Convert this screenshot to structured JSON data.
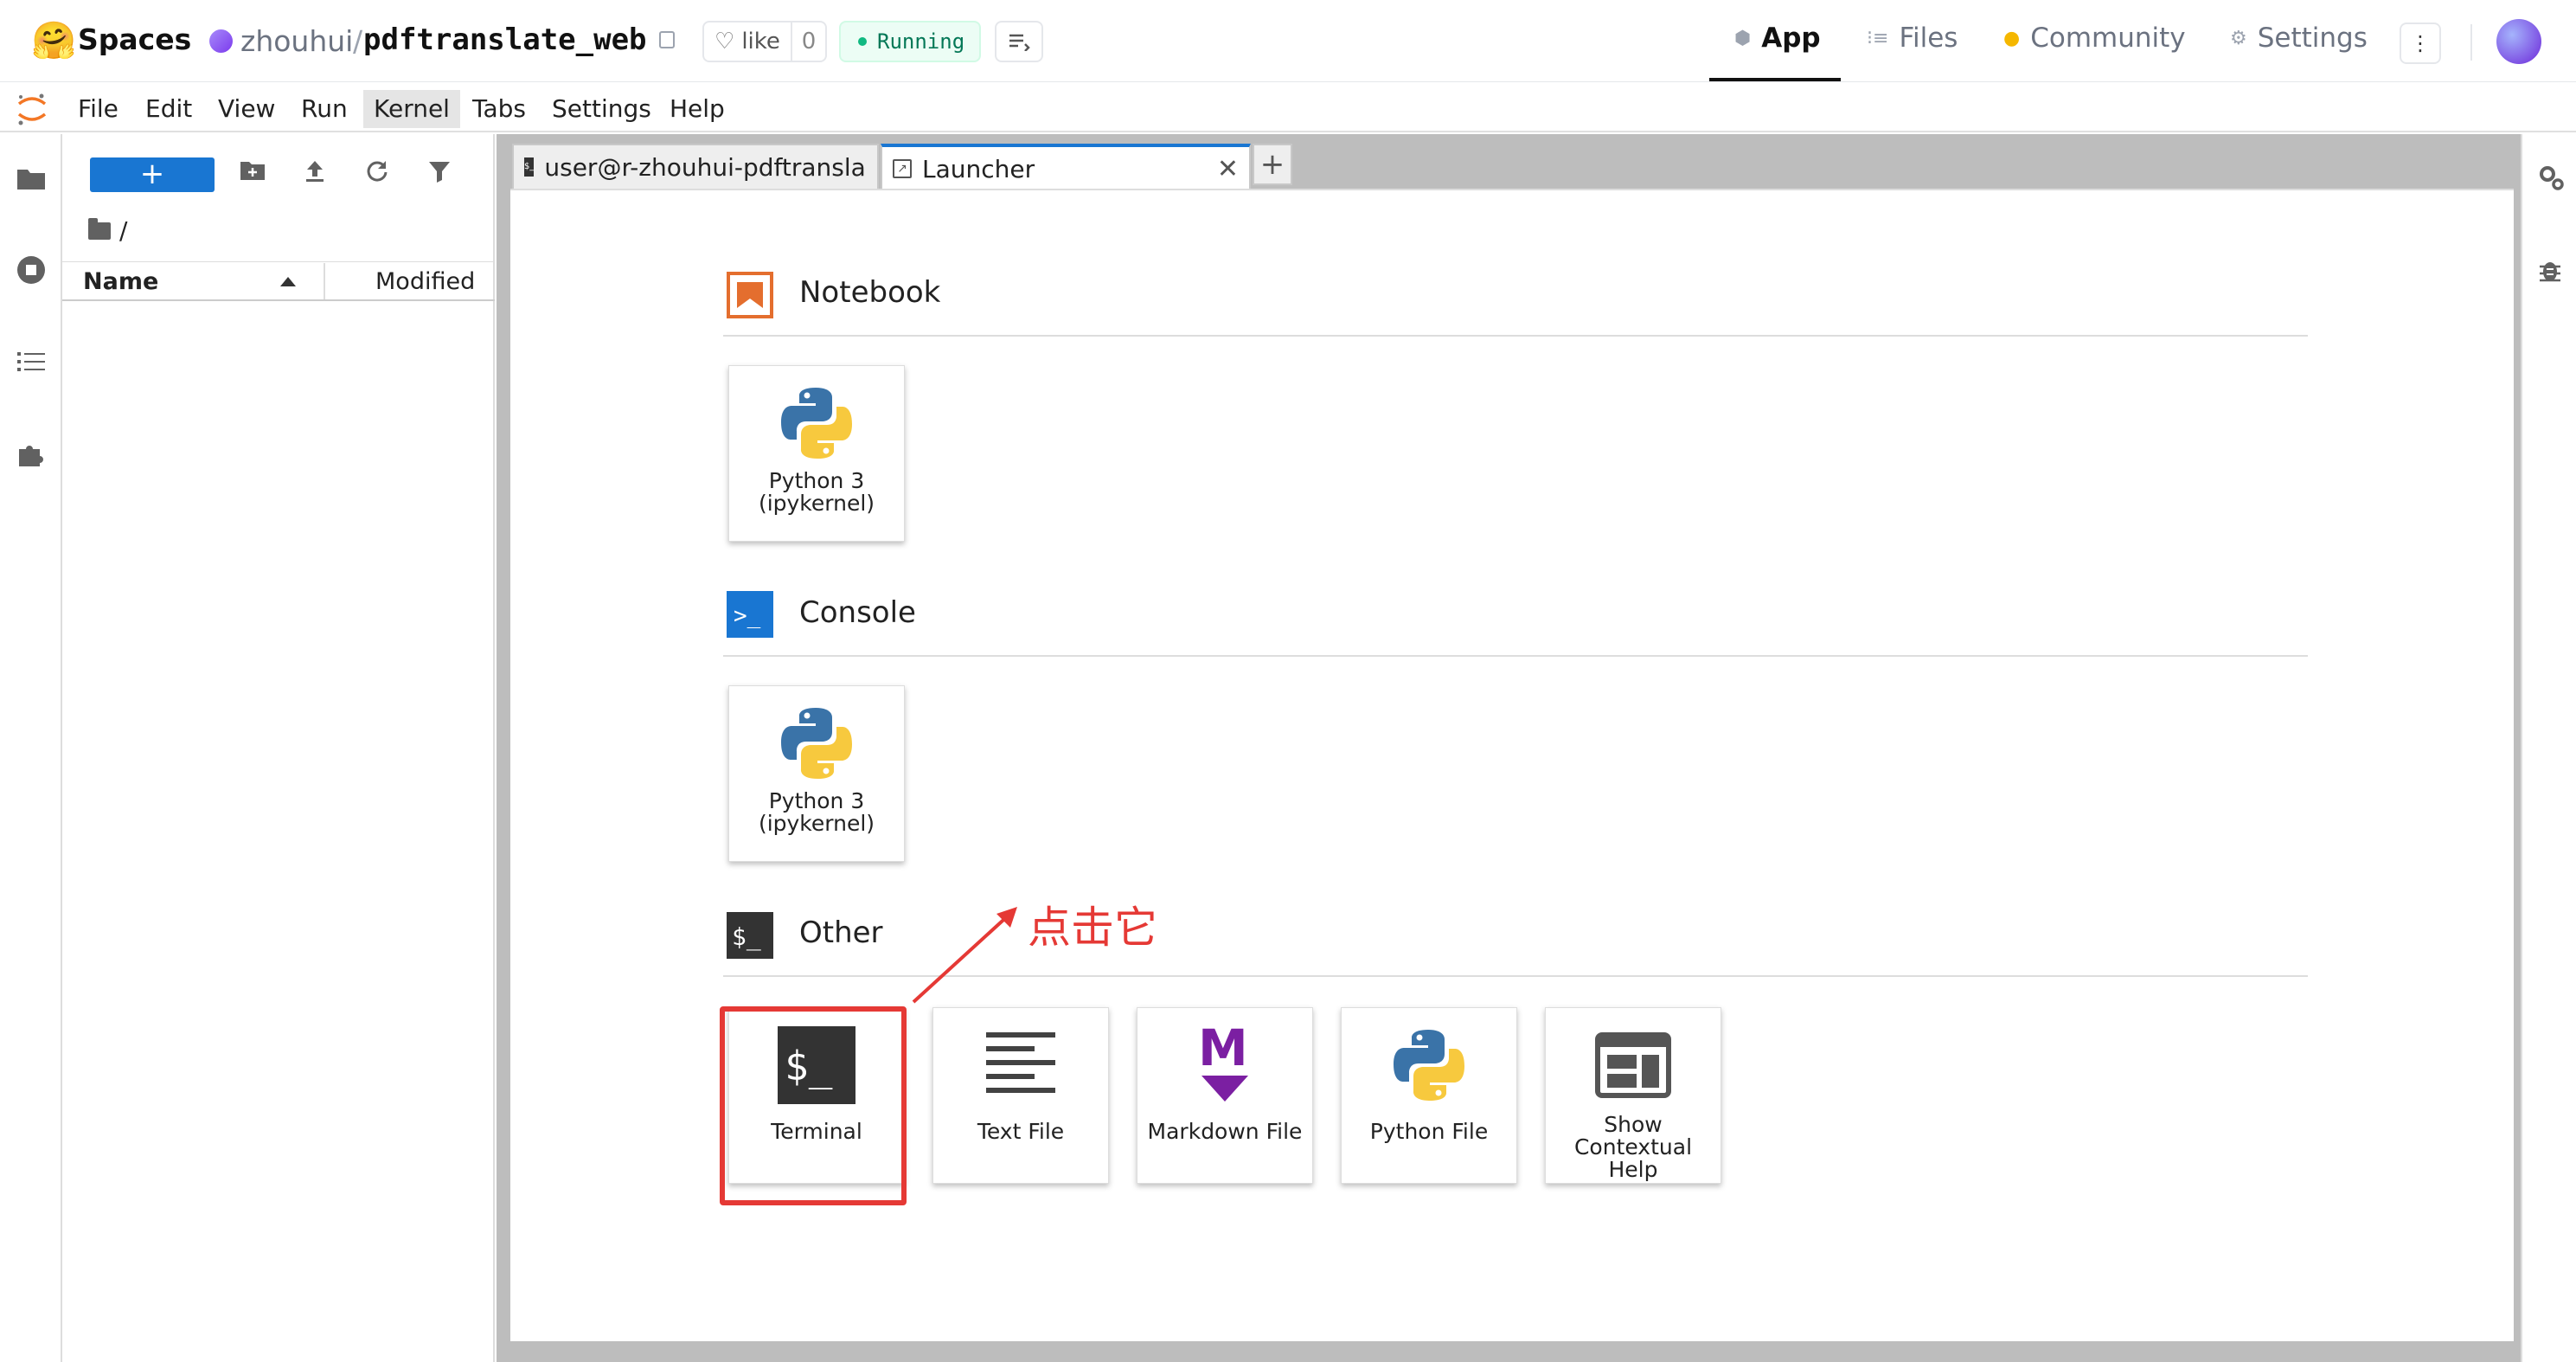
{
  "hf": {
    "logo": "🤗",
    "spaces": "Spaces",
    "owner": "zhouhui",
    "slash": "/",
    "repo": "pdftranslate_web",
    "like_label": "like",
    "like_count": "0",
    "status": "Running",
    "nav": {
      "app": "App",
      "files": "Files",
      "community": "Community",
      "settings": "Settings"
    },
    "more": "⋮"
  },
  "menubar": {
    "items": [
      {
        "label": "File"
      },
      {
        "label": "Edit"
      },
      {
        "label": "View"
      },
      {
        "label": "Run"
      },
      {
        "label": "Kernel"
      },
      {
        "label": "Tabs"
      },
      {
        "label": "Settings"
      },
      {
        "label": "Help"
      }
    ]
  },
  "filebrowser": {
    "new_label": "+",
    "path": "/",
    "col_name": "Name",
    "col_modified": "Modified"
  },
  "tabs": [
    {
      "label": "user@r-zhouhui-pdftransla",
      "close": "✕"
    },
    {
      "label": "Launcher",
      "close": "✕"
    }
  ],
  "tab_add": "+",
  "launcher": {
    "sections": [
      {
        "title": "Notebook",
        "cards": [
          {
            "label": "Python 3\n(ipykernel)"
          }
        ]
      },
      {
        "title": "Console",
        "cards": [
          {
            "label": "Python 3\n(ipykernel)"
          }
        ]
      },
      {
        "title": "Other",
        "cards": [
          {
            "label": "Terminal"
          },
          {
            "label": "Text File"
          },
          {
            "label": "Markdown File"
          },
          {
            "label": "Python File"
          },
          {
            "label": "Show\nContextual\nHelp"
          }
        ]
      }
    ],
    "console_icon_text": ">_",
    "other_icon_text": "$_",
    "terminal_icon_text": "$_",
    "markdown_icon_text": "M"
  },
  "annotation": {
    "text": "点击它",
    "color": "#e53935"
  },
  "colors": {
    "accent": "#1976d2",
    "notebook_orange": "#e46e2e",
    "markdown_purple": "#7b1fa2"
  }
}
